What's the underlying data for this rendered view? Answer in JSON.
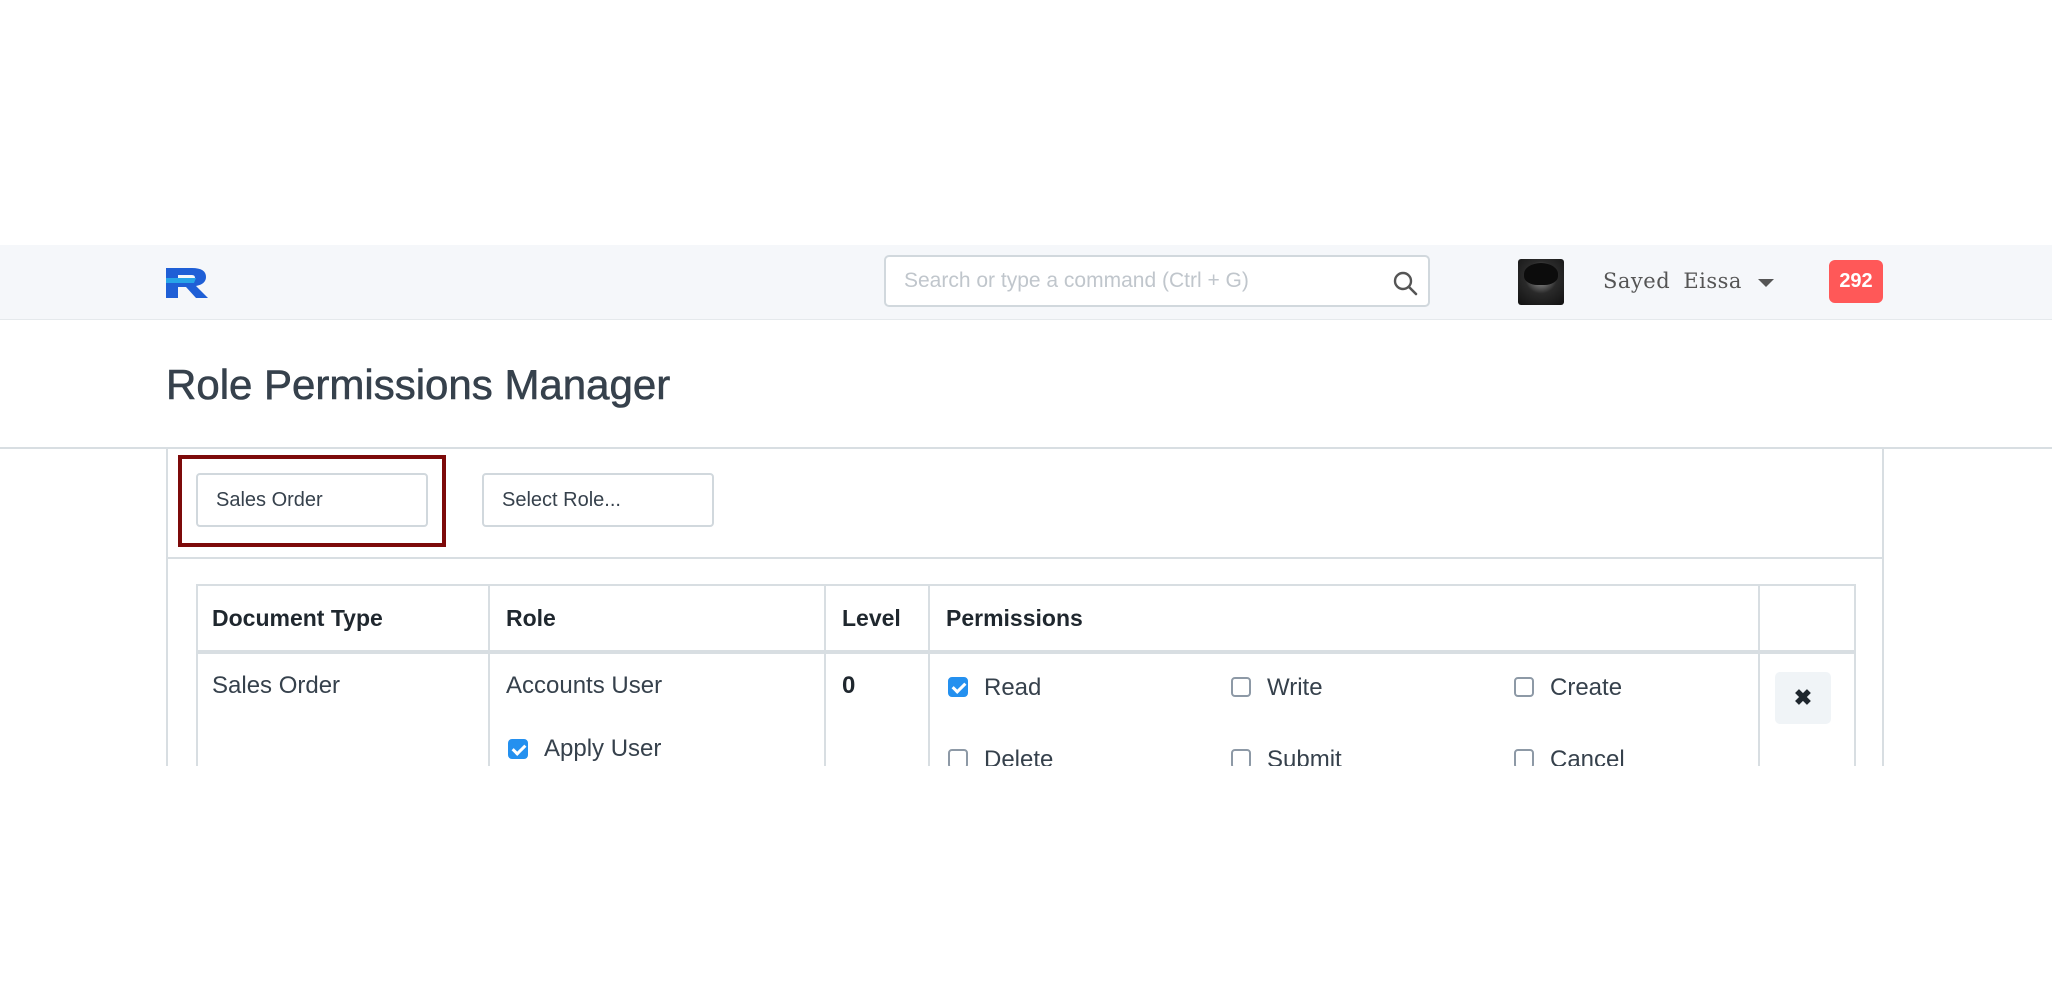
{
  "navbar": {
    "logo_icon": "brand-logo-icon",
    "search": {
      "placeholder": "Search or type a command (Ctrl + G)",
      "value": "",
      "icon": "search-icon"
    },
    "user": {
      "name": "Sayed  Eissa",
      "avatar_icon": "user-avatar",
      "dropdown_icon": "caret-down-icon"
    },
    "notifications": {
      "count": "292",
      "color": "#ff5858"
    }
  },
  "page": {
    "title": "Role Permissions Manager"
  },
  "filters": {
    "doctype": {
      "value": "Sales Order",
      "highlight_color": "#7d0a0a"
    },
    "role": {
      "value": "Select Role..."
    }
  },
  "table": {
    "headers": {
      "document_type": "Document Type",
      "role": "Role",
      "level": "Level",
      "permissions": "Permissions"
    },
    "rows": [
      {
        "document_type": "Sales Order",
        "role": "Accounts User",
        "level": "0",
        "apply_user": {
          "label": "Apply User",
          "checked": true
        },
        "permissions": [
          {
            "label": "Read",
            "checked": true
          },
          {
            "label": "Write",
            "checked": false
          },
          {
            "label": "Create",
            "checked": false
          },
          {
            "label": "Delete",
            "checked": false
          },
          {
            "label": "Submit",
            "checked": false
          },
          {
            "label": "Cancel",
            "checked": false
          }
        ],
        "remove_icon": "close-icon"
      }
    ]
  },
  "colors": {
    "checkbox_checked": "#2490ef",
    "navbar_bg": "#f5f7fa"
  }
}
